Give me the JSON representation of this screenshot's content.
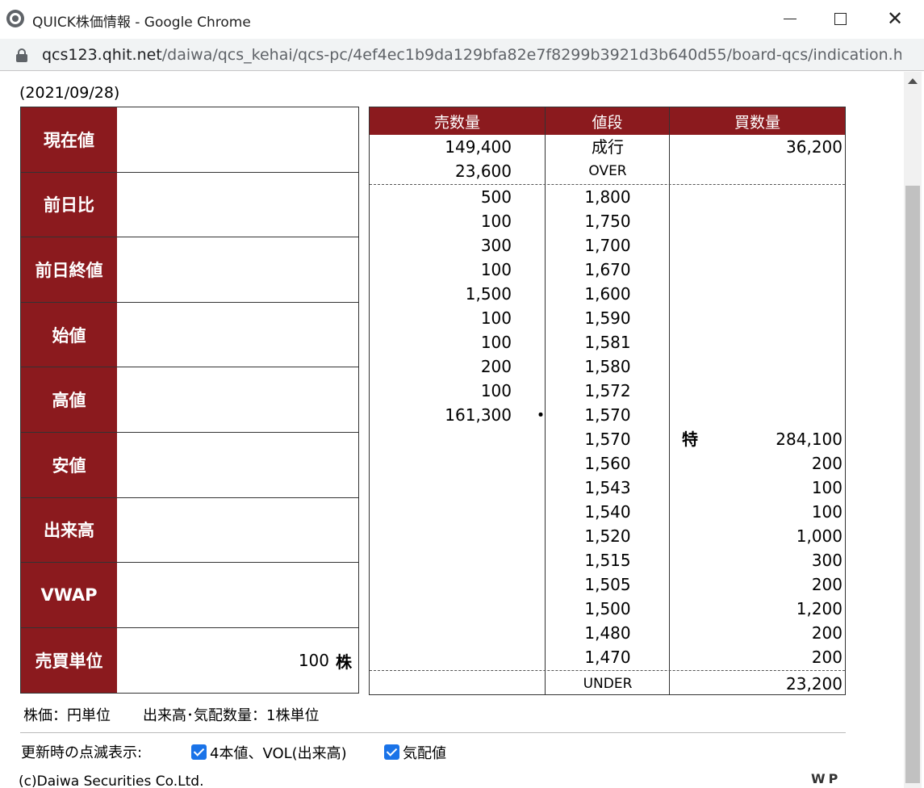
{
  "window": {
    "title": "QUICK株価情報 - Google Chrome",
    "url_host": "qcs123.qhit.net",
    "url_path": "/daiwa/qcs_kehai/qcs-pc/4ef4ec1b9da129bfa82e7f8299b3921d3b640d55/board-qcs/indication.ht..."
  },
  "date": "(2021/09/28)",
  "quote": {
    "rows": [
      {
        "label": "現在値",
        "value": "",
        "unit": ""
      },
      {
        "label": "前日比",
        "value": "",
        "unit": ""
      },
      {
        "label": "前日終値",
        "value": "",
        "unit": ""
      },
      {
        "label": "始値",
        "value": "",
        "unit": ""
      },
      {
        "label": "高値",
        "value": "",
        "unit": ""
      },
      {
        "label": "安値",
        "value": "",
        "unit": ""
      },
      {
        "label": "出来高",
        "value": "",
        "unit": ""
      },
      {
        "label": "VWAP",
        "value": "",
        "unit": ""
      },
      {
        "label": "売買単位",
        "value": "100",
        "unit": "株"
      }
    ]
  },
  "board": {
    "headers": {
      "sell": "売数量",
      "price": "値段",
      "buy": "買数量"
    },
    "market_row": {
      "sell": "149,400",
      "price": "成行",
      "buy": "36,200"
    },
    "over_row": {
      "sell": "23,600",
      "price": "OVER",
      "buy": ""
    },
    "rows": [
      {
        "sell": "500",
        "dot": "",
        "price": "1,800",
        "mark": "",
        "buy": ""
      },
      {
        "sell": "100",
        "dot": "",
        "price": "1,750",
        "mark": "",
        "buy": ""
      },
      {
        "sell": "300",
        "dot": "",
        "price": "1,700",
        "mark": "",
        "buy": ""
      },
      {
        "sell": "100",
        "dot": "",
        "price": "1,670",
        "mark": "",
        "buy": ""
      },
      {
        "sell": "1,500",
        "dot": "",
        "price": "1,600",
        "mark": "",
        "buy": ""
      },
      {
        "sell": "100",
        "dot": "",
        "price": "1,590",
        "mark": "",
        "buy": ""
      },
      {
        "sell": "100",
        "dot": "",
        "price": "1,581",
        "mark": "",
        "buy": ""
      },
      {
        "sell": "200",
        "dot": "",
        "price": "1,580",
        "mark": "",
        "buy": ""
      },
      {
        "sell": "100",
        "dot": "",
        "price": "1,572",
        "mark": "",
        "buy": ""
      },
      {
        "sell": "161,300",
        "dot": "・",
        "price": "1,570",
        "mark": "",
        "buy": ""
      },
      {
        "sell": "",
        "dot": "",
        "price": "1,570",
        "mark": "特",
        "buy": "284,100"
      },
      {
        "sell": "",
        "dot": "",
        "price": "1,560",
        "mark": "",
        "buy": "200"
      },
      {
        "sell": "",
        "dot": "",
        "price": "1,543",
        "mark": "",
        "buy": "100"
      },
      {
        "sell": "",
        "dot": "",
        "price": "1,540",
        "mark": "",
        "buy": "100"
      },
      {
        "sell": "",
        "dot": "",
        "price": "1,520",
        "mark": "",
        "buy": "1,000"
      },
      {
        "sell": "",
        "dot": "",
        "price": "1,515",
        "mark": "",
        "buy": "300"
      },
      {
        "sell": "",
        "dot": "",
        "price": "1,505",
        "mark": "",
        "buy": "200"
      },
      {
        "sell": "",
        "dot": "",
        "price": "1,500",
        "mark": "",
        "buy": "1,200"
      },
      {
        "sell": "",
        "dot": "",
        "price": "1,480",
        "mark": "",
        "buy": "200"
      },
      {
        "sell": "",
        "dot": "",
        "price": "1,470",
        "mark": "",
        "buy": "200"
      }
    ],
    "under_row": {
      "sell": "",
      "price": "UNDER",
      "buy": "23,200"
    }
  },
  "notes": {
    "price_unit": "株価：円単位",
    "volume_unit": "出来高･気配数量：1株単位"
  },
  "flash": {
    "label": "更新時の点滅表示:",
    "option1": "4本値、VOL(出来高)",
    "option1_checked": true,
    "option2": "気配値",
    "option2_checked": true
  },
  "footer": {
    "copyright": "(c)Daiwa Securities Co.Ltd.",
    "logo": "WP"
  }
}
